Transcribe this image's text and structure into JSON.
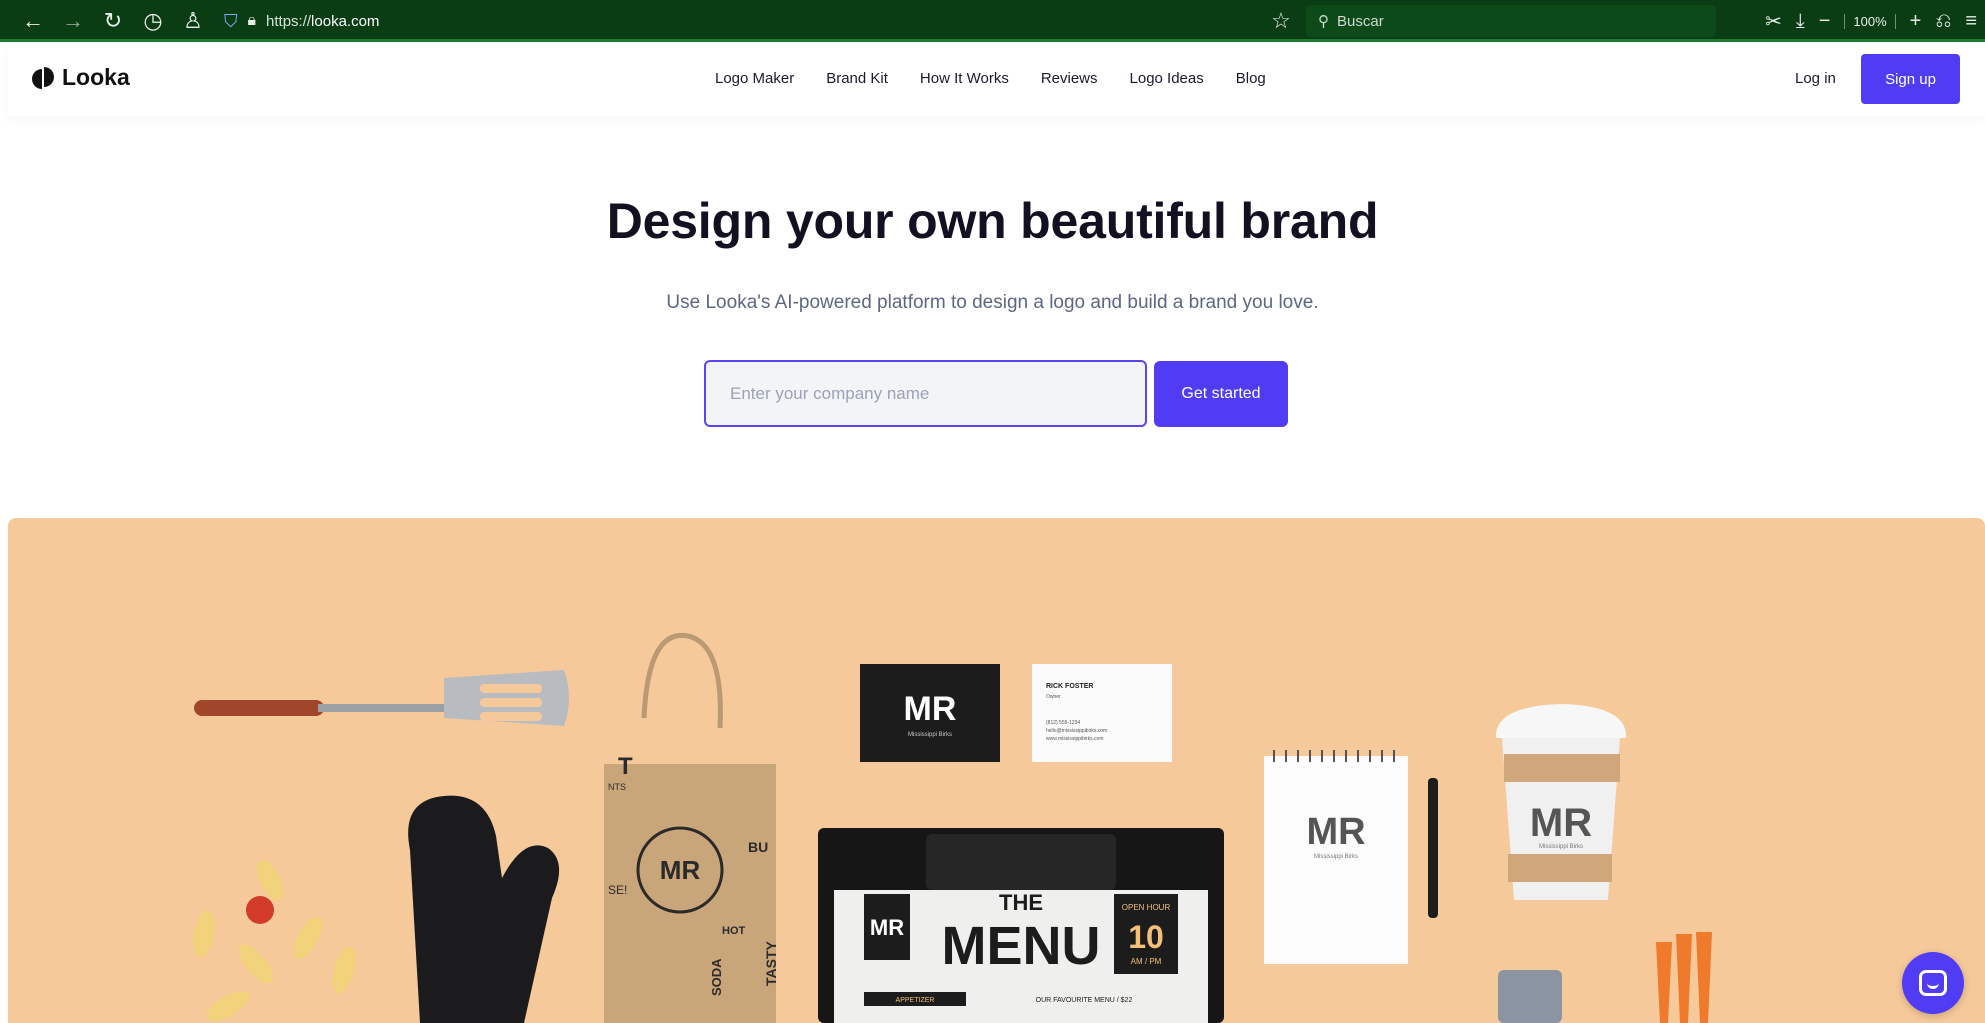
{
  "browser": {
    "url_prefix": "https://",
    "url_domain": "looka.com",
    "search_placeholder": "Buscar",
    "zoom": "100%"
  },
  "site": {
    "logo_text": "Looka",
    "nav": [
      "Logo Maker",
      "Brand Kit",
      "How It Works",
      "Reviews",
      "Logo Ideas",
      "Blog"
    ],
    "login_label": "Log in",
    "signup_label": "Sign up"
  },
  "hero": {
    "title": "Design your own beautiful brand",
    "subtitle": "Use Looka's AI-powered platform to design a logo and build a brand you love.",
    "input_placeholder": "Enter your company name",
    "cta_label": "Get started"
  },
  "banner": {
    "brand_mark": "MR",
    "brand_tagline": "Mississippi Birks",
    "card_name": "RICK FOSTER",
    "card_role": "Owner",
    "card_lines": [
      "(812) 555-1234",
      "hello@mississippibirks.com",
      "www.mississippibirks.com"
    ],
    "menu_the": "THE",
    "menu_word": "MENU",
    "open_hour_label": "OPEN HOUR",
    "open_hour_value": "10",
    "open_hour_unit": "AM / PM",
    "appetizer_label": "APPETIZER",
    "favourite_label": "OUR FAVOURITE MENU / $22",
    "bag_words": [
      "TASTY",
      "SODA",
      "HOT",
      "BU",
      "SE!",
      "NTS",
      "T"
    ]
  },
  "colors": {
    "browser_bg": "#0a3d14",
    "accent": "#4f3cf4",
    "banner_bg": "#f6c99a"
  }
}
